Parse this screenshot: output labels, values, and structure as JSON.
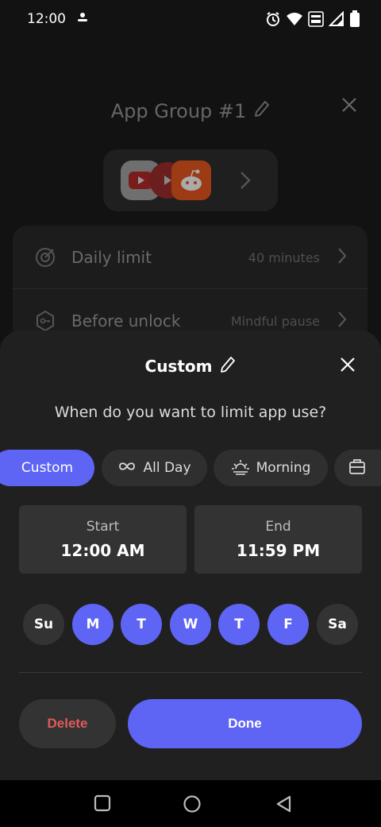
{
  "status_bar": {
    "time": "12:00"
  },
  "background": {
    "title": "App Group #1",
    "rows": [
      {
        "label": "Daily limit",
        "value": "40 minutes"
      },
      {
        "label": "Before unlock",
        "value": "Mindful pause"
      }
    ]
  },
  "sheet": {
    "title": "Custom",
    "question": "When do you want to limit app use?",
    "chips": [
      {
        "label": "Custom",
        "selected": true
      },
      {
        "label": "All Day",
        "selected": false
      },
      {
        "label": "Morning",
        "selected": false
      }
    ],
    "start": {
      "label": "Start",
      "value": "12:00 AM"
    },
    "end": {
      "label": "End",
      "value": "11:59 PM"
    },
    "days": [
      {
        "label": "Su",
        "selected": false
      },
      {
        "label": "M",
        "selected": true
      },
      {
        "label": "T",
        "selected": true
      },
      {
        "label": "W",
        "selected": true
      },
      {
        "label": "T",
        "selected": true
      },
      {
        "label": "F",
        "selected": true
      },
      {
        "label": "Sa",
        "selected": false
      }
    ],
    "delete_label": "Delete",
    "done_label": "Done"
  },
  "colors": {
    "accent": "#5e64f4",
    "danger": "#e05a5a",
    "sheet_bg": "#202020"
  }
}
